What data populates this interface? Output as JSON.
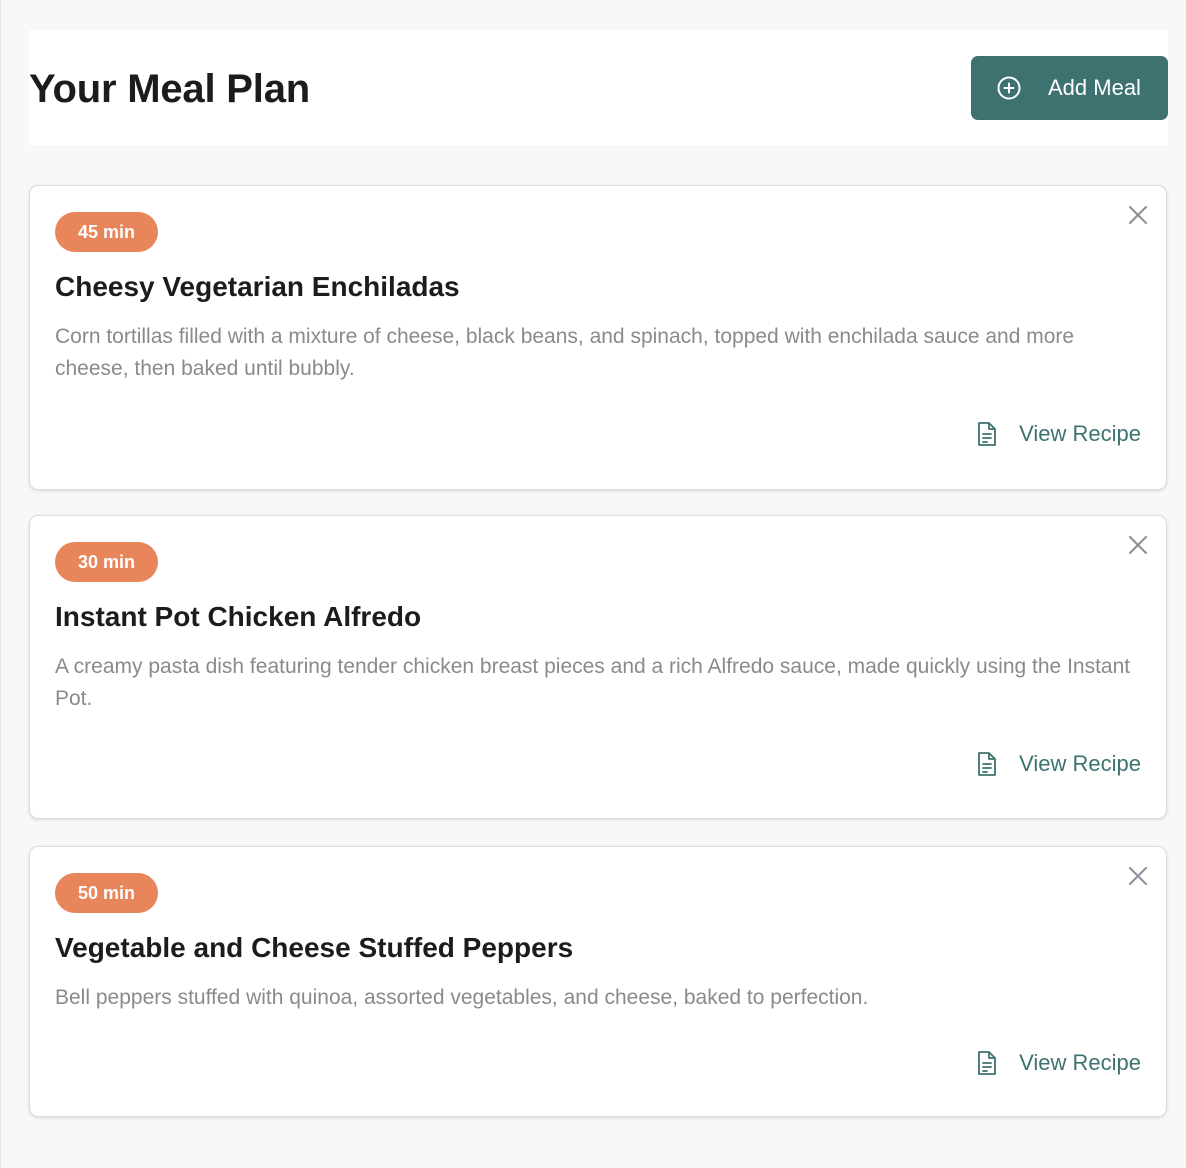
{
  "header": {
    "title": "Your Meal Plan",
    "add_button_label": "Add Meal",
    "add_button_icon": "plus-circle-icon"
  },
  "colors": {
    "accent": "#3d7271",
    "badge": "#e9855a",
    "text_primary": "#1c1c1c",
    "text_secondary": "#8a8a8a",
    "close_icon": "#8e939b"
  },
  "meals": [
    {
      "time": "45 min",
      "title": "Cheesy Vegetarian Enchiladas",
      "description": "Corn tortillas filled with a mixture of cheese, black beans, and spinach, topped with enchilada sauce and more cheese, then baked until bubbly.",
      "action_label": "View Recipe"
    },
    {
      "time": "30 min",
      "title": "Instant Pot Chicken Alfredo",
      "description": "A creamy pasta dish featuring tender chicken breast pieces and a rich Alfredo sauce, made quickly using the Instant Pot.",
      "action_label": "View Recipe"
    },
    {
      "time": "50 min",
      "title": "Vegetable and Cheese Stuffed Peppers",
      "description": "Bell peppers stuffed with quinoa, assorted vegetables, and cheese, baked to perfection.",
      "action_label": "View Recipe"
    }
  ]
}
